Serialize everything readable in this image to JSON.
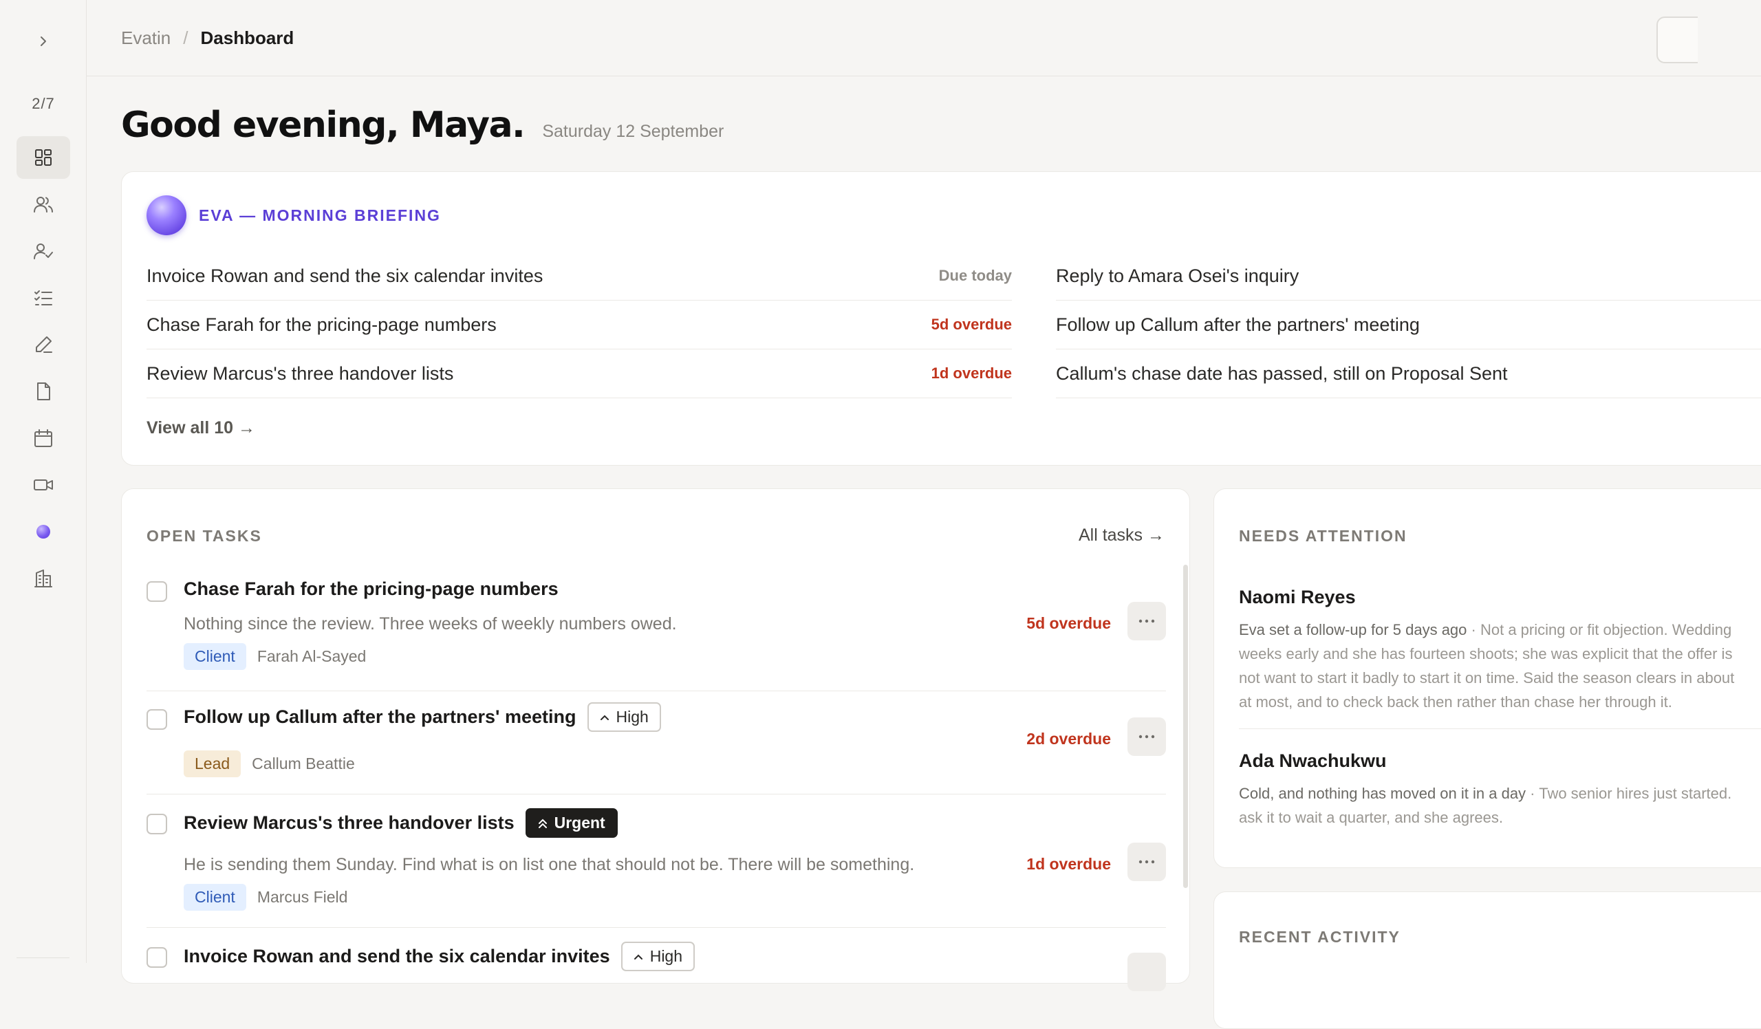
{
  "sidebar": {
    "counter": "2/7",
    "items": [
      {
        "name": "dashboard-icon",
        "active": true
      },
      {
        "name": "people-icon",
        "active": false
      },
      {
        "name": "user-check-icon",
        "active": false
      },
      {
        "name": "checklist-icon",
        "active": false
      },
      {
        "name": "pen-icon",
        "active": false
      },
      {
        "name": "document-icon",
        "active": false
      },
      {
        "name": "calendar-icon",
        "active": false
      },
      {
        "name": "video-icon",
        "active": false
      },
      {
        "name": "eva-orb-icon",
        "active": false
      },
      {
        "name": "building-icon",
        "active": false
      }
    ]
  },
  "header": {
    "breadcrumb_root": "Evatin",
    "breadcrumb_separator": "/",
    "breadcrumb_current": "Dashboard"
  },
  "greeting": {
    "title": "Good evening, Maya.",
    "date": "Saturday 12 September"
  },
  "briefing": {
    "title": "EVA — MORNING BRIEFING",
    "left": [
      {
        "text": "Invoice Rowan and send the six calendar invites",
        "status": "Due today",
        "status_kind": "due"
      },
      {
        "text": "Chase Farah for the pricing-page numbers",
        "status": "5d overdue",
        "status_kind": "overdue"
      },
      {
        "text": "Review Marcus's three handover lists",
        "status": "1d overdue",
        "status_kind": "overdue"
      }
    ],
    "right": [
      {
        "text": "Reply to Amara Osei's inquiry"
      },
      {
        "text": "Follow up Callum after the partners' meeting"
      },
      {
        "text": "Callum's chase date has passed, still on Proposal Sent"
      }
    ],
    "view_all": "View all 10 →"
  },
  "tasks": {
    "title": "OPEN TASKS",
    "all_link": "All tasks →",
    "items": [
      {
        "title": "Chase Farah for the pricing-page numbers",
        "description": "Nothing since the review. Three weeks of weekly numbers owed.",
        "tag": "Client",
        "person": "Farah Al-Sayed",
        "due": "5d overdue"
      },
      {
        "title": "Follow up Callum after the partners' meeting",
        "priority": "High",
        "tag": "Lead",
        "person": "Callum Beattie",
        "due": "2d overdue"
      },
      {
        "title": "Review Marcus's three handover lists",
        "priority": "Urgent",
        "description": "He is sending them Sunday. Find what is on list one that should not be. There will be something.",
        "tag": "Client",
        "person": "Marcus Field",
        "due": "1d overdue"
      },
      {
        "title": "Invoice Rowan and send the six calendar invites",
        "priority": "High"
      }
    ]
  },
  "attention": {
    "title": "NEEDS ATTENTION",
    "items": [
      {
        "name": "Naomi Reyes",
        "lead_in": "Eva set a follow-up for 5 days ago",
        "lines": [
          " · Not a pricing or fit objection. Wedding",
          "weeks early and she has fourteen shoots; she was explicit that the offer is",
          "not want to start it badly to start it on time. Said the season clears in about",
          "at most, and to check back then rather than chase her through it."
        ]
      },
      {
        "name": "Ada Nwachukwu",
        "lead_in": "Cold, and nothing has moved on it in a day",
        "lines": [
          " · Two senior hires just started.",
          "ask it to wait a quarter, and she agrees."
        ]
      }
    ]
  },
  "recent": {
    "title": "RECENT ACTIVITY"
  },
  "colors": {
    "accent": "#5b3fd6",
    "overdue": "#c0341d",
    "background": "#f6f5f3"
  }
}
